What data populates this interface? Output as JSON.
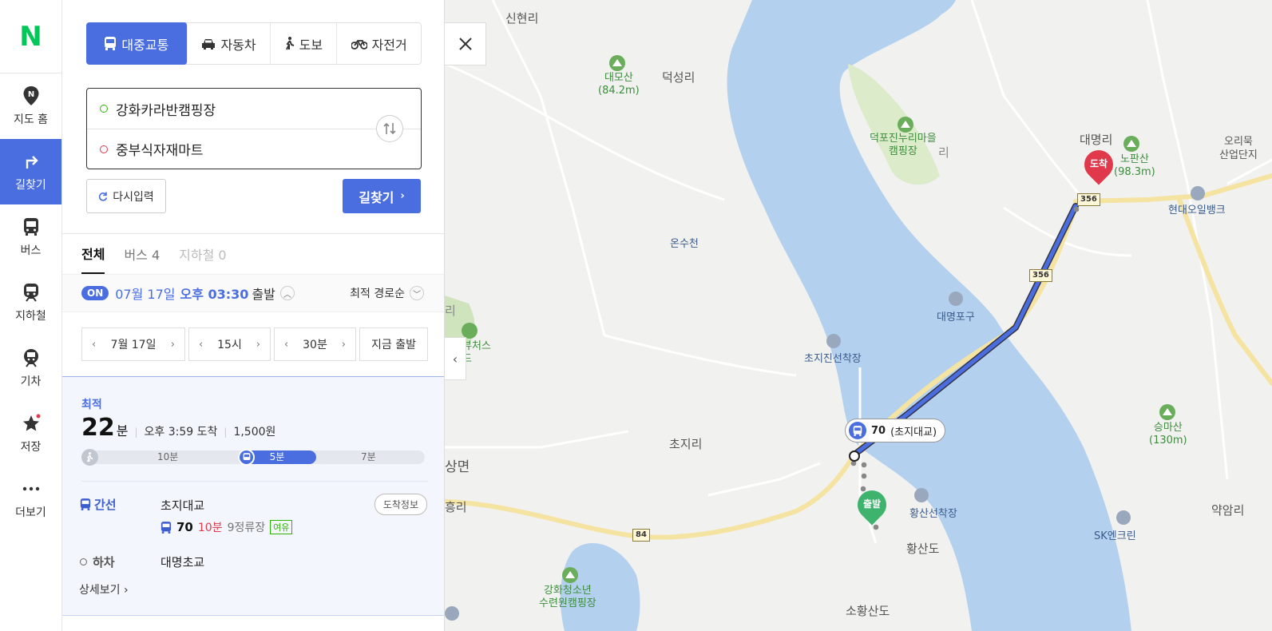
{
  "rail": {
    "logo": "N",
    "items": [
      {
        "label": "지도 홈",
        "icon": "map-home-icon"
      },
      {
        "label": "길찾기",
        "icon": "directions-icon"
      },
      {
        "label": "버스",
        "icon": "bus-icon"
      },
      {
        "label": "지하철",
        "icon": "subway-icon"
      },
      {
        "label": "기차",
        "icon": "train-icon"
      },
      {
        "label": "저장",
        "icon": "star-icon"
      },
      {
        "label": "더보기",
        "icon": "more-icon"
      }
    ]
  },
  "modes": [
    "대중교통",
    "자동차",
    "도보",
    "자전거"
  ],
  "route_input": {
    "origin": "강화카라반캠핑장",
    "destination": "중부식자재마트"
  },
  "buttons": {
    "reset": "다시입력",
    "search": "길찾기"
  },
  "tabs": [
    {
      "label": "전체"
    },
    {
      "label": "버스 4"
    },
    {
      "label": "지하철 0"
    }
  ],
  "depart": {
    "badge": "ON",
    "date": "07월 17일",
    "time": "오후 03:30",
    "label": "출발",
    "sort": "최적 경로순"
  },
  "pickers": {
    "date": "7월 17일",
    "hour": "15시",
    "minute": "30분",
    "now": "지금 출발"
  },
  "route": {
    "tag": "최적",
    "minutes": "22",
    "minutes_unit": "분",
    "arrival": "오후 3:59 도착",
    "fare": "1,500원",
    "walk1": "10분",
    "bus": "5분",
    "walk2": "7분",
    "board_type": "간선",
    "board_stop": "초지대교",
    "arrival_info_btn": "도착정보",
    "bus_number": "70",
    "bus_wait": "10분",
    "bus_stops": "9정류장",
    "bus_seat": "여유",
    "alight_label": "하차",
    "alight_stop": "대명초교",
    "detail": "상세보기"
  },
  "map": {
    "labels": {
      "sinhyeon": "신현리",
      "daemosan": "대모산\n(84.2m)",
      "deokseong": "덕성리",
      "deokpo_camp": "덕포진누리마을\n캠핑장",
      "ri": "리",
      "daemyeong": "대명리",
      "nopansan": "노판산\n(98.3m)",
      "orimuk": "오리묵",
      "sanup": "산업단지",
      "hyundai_oil": "현대오일뱅크",
      "onsucheon": "온수천",
      "daemyeong_port": "대명포구",
      "chojijin": "초지진선착장",
      "chojiri": "초지리",
      "seungmasan": "승마산\n(130m)",
      "sangmyeon": "상면",
      "heungri": "흥리",
      "hwangsan_dock": "황산선착장",
      "hwangsando": "황산도",
      "sohwangsando": "소황산도",
      "sk": "SK엔크린",
      "yakamri": "약암리",
      "ganghwa_camp": "강화청소년\n수련원캠핑장",
      "view_ri": "리",
      "view": "뷰처스",
      "view2": "드"
    },
    "routes": {
      "r356a": "356",
      "r356b": "356",
      "r84": "84"
    },
    "bus_bubble_number": "70",
    "bus_bubble_stop": "(초지대교)",
    "pin_end": "도착",
    "pin_start": "출발"
  }
}
